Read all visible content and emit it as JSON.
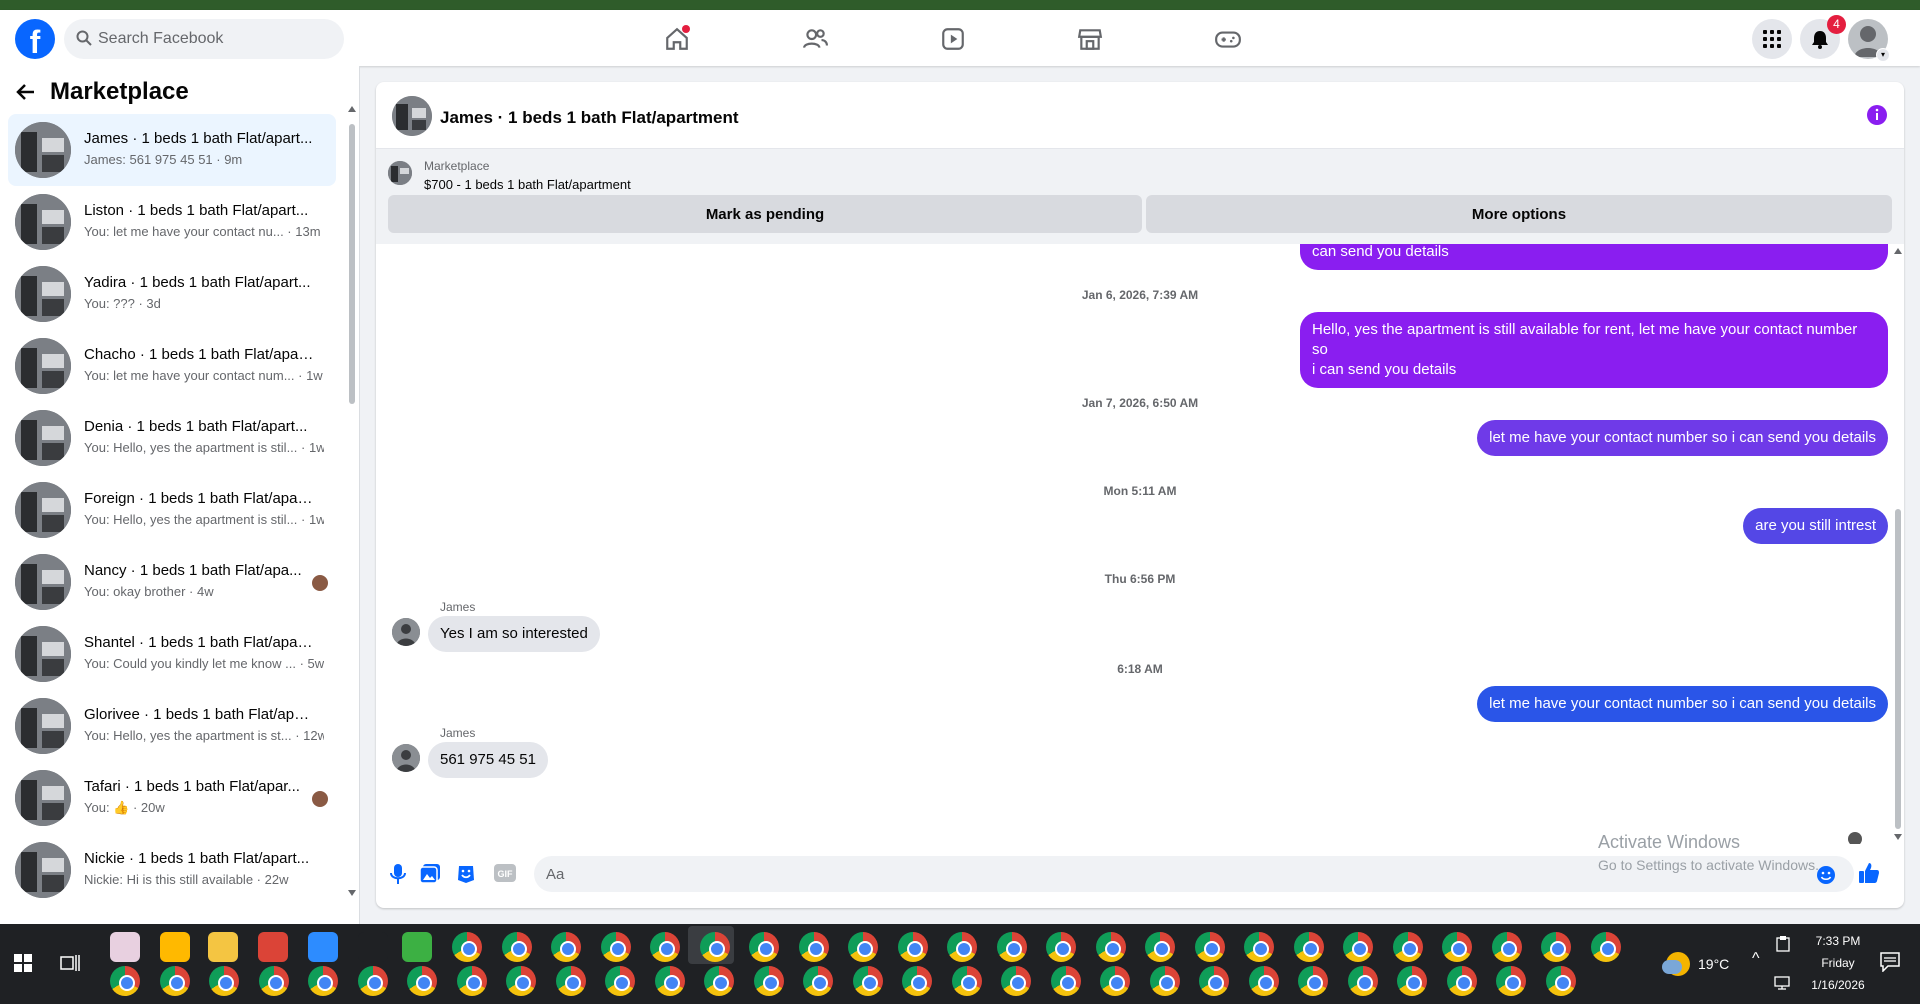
{
  "nav": {
    "logo_letter": "f",
    "search_placeholder": "Search Facebook",
    "notifications_count": "4",
    "icons": [
      "home-icon",
      "friends-icon",
      "video-icon",
      "marketplace-icon",
      "gaming-icon"
    ]
  },
  "sidebar": {
    "title": "Marketplace",
    "conversations": [
      {
        "name": "James · 1 beds 1 bath Flat/apart...",
        "preview": "James: 561 975 45 51 · 9m",
        "active": true
      },
      {
        "name": "Liston · 1 beds 1 bath Flat/apart...",
        "preview": "You: let me have your contact nu... · 13m"
      },
      {
        "name": "Yadira · 1 beds 1 bath Flat/apart...",
        "preview": "You: ??? · 3d"
      },
      {
        "name": "Chacho · 1 beds 1 bath Flat/apar...",
        "preview": "You: let me have your contact num... · 1w"
      },
      {
        "name": "Denia · 1 beds 1 bath Flat/apart...",
        "preview": "You: Hello, yes the apartment is stil... · 1w"
      },
      {
        "name": "Foreign · 1 beds 1 bath Flat/apar...",
        "preview": "You: Hello, yes the apartment is stil... · 1w"
      },
      {
        "name": "Nancy · 1 beds 1 bath Flat/apa...",
        "preview": "You: okay brother · 4w"
      },
      {
        "name": "Shantel · 1 beds 1 bath Flat/apar...",
        "preview": "You: Could you kindly let me know ... · 5w"
      },
      {
        "name": "Glorivee · 1 beds 1 bath Flat/apa...",
        "preview": "You: Hello, yes the apartment is st... · 12w"
      },
      {
        "name": "Tafari · 1 beds 1 bath Flat/apar...",
        "preview": "You: 👍 · 20w"
      },
      {
        "name": "Nickie · 1 beds 1 bath Flat/apart...",
        "preview": "Nickie: Hi is this still available · 22w"
      }
    ]
  },
  "chat": {
    "title": "James · 1 beds 1 bath Flat/apartment",
    "marketplace_label": "Marketplace",
    "listing": "$700 - 1 beds 1 bath Flat/apartment",
    "mark_pending": "Mark as pending",
    "more_options": "More options",
    "timestamps": [
      "Jan 6, 2026, 7:39 AM",
      "Jan 7, 2026, 6:50 AM",
      "Mon 5:11 AM",
      "Thu 6:56 PM",
      "6:18 AM"
    ],
    "messages": {
      "m0": "can send you details",
      "m1_line1": "Hello, yes the apartment is still available for rent, let me have your contact number so",
      "m1_line2": "i can send you details",
      "m2": "let me have your contact number so i can send you details",
      "m3": "are you still intrest",
      "m4_sender": "James",
      "m4": "Yes I am so interested",
      "m5": "let me have your contact number so i can send you details",
      "m6_sender": "James",
      "m6": "561 975 45 51"
    },
    "input_placeholder": "Aa",
    "bubble_purple": "#8a1ef0",
    "bubble_blue": "#2a55e8"
  },
  "watermark": {
    "line1": "Activate Windows",
    "line2": "Go to Settings to activate Windows."
  },
  "taskbar": {
    "temperature": "19°C",
    "time": "7:33 PM",
    "day": "Friday",
    "date": "1/16/2026"
  }
}
